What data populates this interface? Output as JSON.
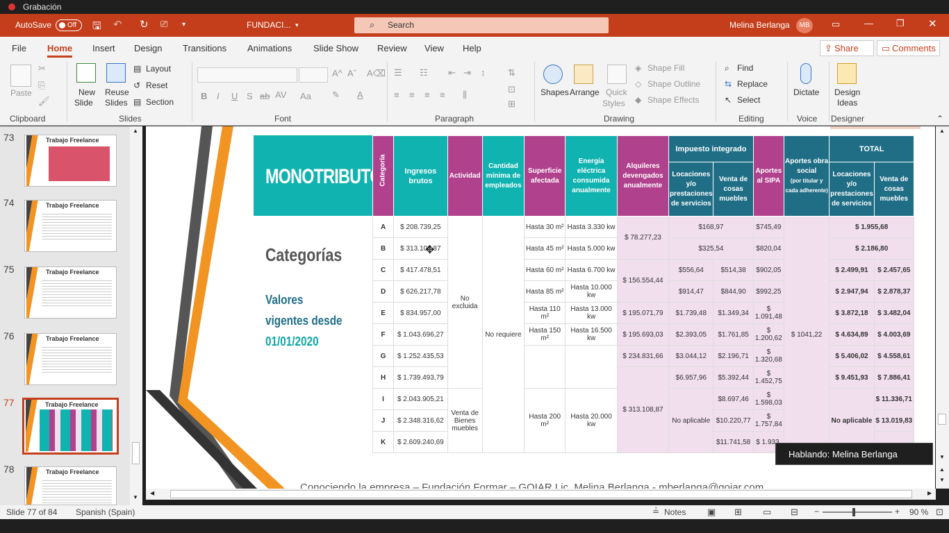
{
  "recording": {
    "label": "Grabación"
  },
  "titlebar": {
    "autosave_label": "AutoSave",
    "autosave_state": "Off",
    "file_name": "FUNDACI...",
    "search_placeholder": "Search",
    "user_name": "Melina Berlanga",
    "user_initials": "MB"
  },
  "menu": {
    "tabs": [
      "File",
      "Home",
      "Insert",
      "Design",
      "Transitions",
      "Animations",
      "Slide Show",
      "Review",
      "View",
      "Help"
    ],
    "share": "Share",
    "comments": "Comments"
  },
  "ribbon": {
    "clipboard": {
      "paste": "Paste",
      "group": "Clipboard"
    },
    "slides": {
      "new_slide": "New",
      "new_slide2": "Slide",
      "reuse": "Reuse",
      "reuse2": "Slides",
      "layout": "Layout",
      "reset": "Reset",
      "section": "Section",
      "group": "Slides"
    },
    "font": {
      "bold": "B",
      "italic": "I",
      "underline": "U",
      "strike": "S",
      "abc": "ab",
      "aa": "Aa",
      "group": "Font"
    },
    "paragraph": {
      "group": "Paragraph"
    },
    "drawing": {
      "shapes": "Shapes",
      "arrange": "Arrange",
      "quick": "Quick",
      "quick2": "Styles",
      "fill": "Shape Fill",
      "outline": "Shape Outline",
      "effects": "Shape Effects",
      "group": "Drawing"
    },
    "editing": {
      "find": "Find",
      "replace": "Replace",
      "select": "Select",
      "group": "Editing"
    },
    "voice": {
      "dictate": "Dictate",
      "group": "Voice"
    },
    "designer": {
      "ideas": "Design",
      "ideas2": "Ideas",
      "group": "Designer"
    }
  },
  "thumbnails": [
    {
      "num": "73",
      "title": "Trabajo Freelance",
      "current": false
    },
    {
      "num": "74",
      "title": "Trabajo Freelance",
      "current": false
    },
    {
      "num": "75",
      "title": "Trabajo Freelance",
      "current": false
    },
    {
      "num": "76",
      "title": "Trabajo Freelance",
      "current": false
    },
    {
      "num": "77",
      "title": "Trabajo Freelance",
      "current": true
    },
    {
      "num": "78",
      "title": "Trabajo Freelance",
      "current": false
    }
  ],
  "slide": {
    "heading": "MONOTRIBUTO",
    "sub1": "Categorías",
    "sub2": "Valores",
    "sub3": "vigentes desde",
    "sub4": "01/01/2020",
    "footer": "Conociendo la empresa – Fundación Formar – GOIAR Lic. Melina Berlanga - mberlanga@goiar.com",
    "headers": {
      "categoria": "Categoría",
      "ingresos": "Ingresos brutos",
      "actividad": "Actividad",
      "empleados": "Cantidad mínima de empleados",
      "superficie": "Superficie afectada",
      "energia": "Energía eléctrica consumida anualmente",
      "alquileres": "Alquileres devengados anualmente",
      "impuesto": "Impuesto integrado",
      "locaciones": "Locaciones y/o prestaciones de servicios",
      "venta": "Venta de cosas muebles",
      "aportes_sipa": "Aportes al SIPA",
      "aportes_os": "Aportes obra social",
      "aportes_os_sub": "(por titular y cada adherente)",
      "total": "TOTAL"
    },
    "rows": [
      {
        "cat": "A",
        "ing": "$ 208.739,25",
        "sup": "Hasta 30 m²",
        "ene": "Hasta 3.330 kw",
        "imp_s": "$168,97",
        "sipa": "$745,49",
        "tot_s": "$ 1.955,68"
      },
      {
        "cat": "B",
        "ing": "$ 313.108,87",
        "sup": "Hasta 45 m²",
        "ene": "Hasta 5.000 kw",
        "imp_s": "$325,54",
        "sipa": "$820,04",
        "tot_s": "$ 2.186,80"
      },
      {
        "cat": "C",
        "ing": "$ 417.478,51",
        "sup": "Hasta 60 m²",
        "ene": "Hasta 6.700 kw",
        "imp_s": "$556,64",
        "imp_v": "$514,38",
        "sipa": "$902,05",
        "tot_s": "$ 2.499,91",
        "tot_v": "$ 2.457,65"
      },
      {
        "cat": "D",
        "ing": "$ 626.217,78",
        "sup": "Hasta 85 m²",
        "ene": "Hasta 10.000 kw",
        "imp_s": "$914,47",
        "imp_v": "$844,90",
        "sipa": "$992,25",
        "tot_s": "$ 2.947,94",
        "tot_v": "$ 2.878,37"
      },
      {
        "cat": "E",
        "ing": "$ 834.957,00",
        "sup": "Hasta 110 m²",
        "ene": "Hasta 13.000 kw",
        "alq": "$ 195.071,79",
        "imp_s": "$1.739,48",
        "imp_v": "$1.349,34",
        "sipa": "$ 1.091,48",
        "tot_s": "$ 3.872,18",
        "tot_v": "$ 3.482,04"
      },
      {
        "cat": "F",
        "ing": "$ 1.043.696,27",
        "sup": "Hasta 150 m²",
        "ene": "Hasta 16.500 kw",
        "alq": "$ 195.693,03",
        "imp_s": "$2.393,05",
        "imp_v": "$1.761,85",
        "sipa": "$ 1.200,62",
        "tot_s": "$ 4.634,89",
        "tot_v": "$ 4.003,69"
      },
      {
        "cat": "G",
        "ing": "$ 1.252.435,53",
        "alq": "$ 234.831,66",
        "imp_s": "$3.044,12",
        "imp_v": "$2.196,71",
        "sipa": "$ 1.320,68",
        "tot_s": "$ 5.406,02",
        "tot_v": "$ 4.558,61"
      },
      {
        "cat": "H",
        "ing": "$ 1.739.493,79",
        "imp_s": "$6.957,96",
        "imp_v": "$5.392,44",
        "sipa": "$ 1.452,75",
        "tot_s": "$ 9.451,93",
        "tot_v": "$ 7.886,41"
      },
      {
        "cat": "I",
        "ing": "$ 2.043.905,21",
        "imp_v": "$8.697,46",
        "sipa": "$ 1.598,03",
        "tot_v": "$ 11.336,71"
      },
      {
        "cat": "J",
        "ing": "$ 2.348.316,62",
        "imp_v": "$10.220,77",
        "sipa": "$ 1.757,84",
        "tot_v": "$ 13.019,83"
      },
      {
        "cat": "K",
        "ing": "$ 2.609.240,69",
        "imp_v": "$11.741,58",
        "sipa": "$ 1.933,"
      }
    ],
    "merged": {
      "no_excluida": "No excluida",
      "no_requiere": "No requiere",
      "venta_bienes": "Venta de Bienes muebles",
      "alq_ab": "$ 78.277,23",
      "alq_cd": "$ 156.554,44",
      "alq_hk": "$ 313.108,87",
      "sup_hk": "Hasta 200 m²",
      "ene_hk": "Hasta 20.000 kw",
      "os": "$ 1041,22",
      "no_aplicable": "No aplicable"
    }
  },
  "speaking": "Hablando: Melina Berlanga",
  "status": {
    "slide": "Slide 77 of 84",
    "lang": "Spanish (Spain)",
    "notes": "Notes",
    "zoom": "90 %"
  }
}
